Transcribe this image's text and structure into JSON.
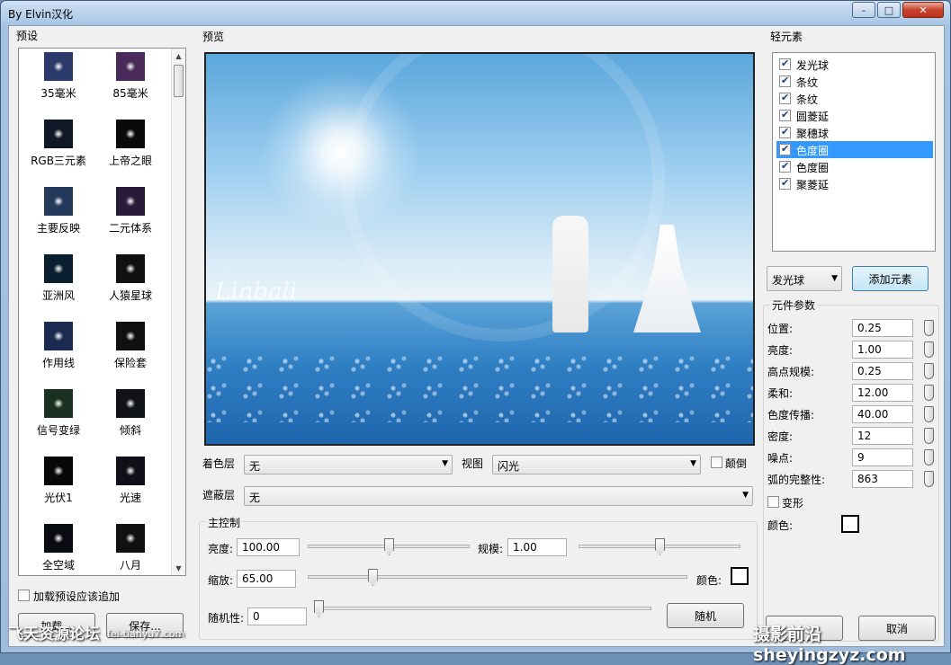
{
  "window": {
    "title": "By Elvin汉化",
    "minimize": "–",
    "maximize": "□",
    "close": "✕"
  },
  "presets": {
    "heading": "预设",
    "items": [
      {
        "label": "35毫米"
      },
      {
        "label": "85毫米"
      },
      {
        "label": "RGB三元素"
      },
      {
        "label": "上帝之眼"
      },
      {
        "label": "主要反映"
      },
      {
        "label": "二元体系"
      },
      {
        "label": "亚洲风"
      },
      {
        "label": "人猿星球"
      },
      {
        "label": "作用线"
      },
      {
        "label": "保险套"
      },
      {
        "label": "信号变绿"
      },
      {
        "label": "倾斜"
      },
      {
        "label": "光伏1"
      },
      {
        "label": "光速"
      },
      {
        "label": "全空域"
      },
      {
        "label": "八月"
      }
    ],
    "append_on_load_label": "加载预设应该追加",
    "load_button": "加载...",
    "save_button": "保存..."
  },
  "preview": {
    "heading": "预览",
    "watermark": "Linbali"
  },
  "layers": {
    "color_layer_label": "着色层",
    "color_layer_value": "无",
    "view_label": "视图",
    "view_value": "闪光",
    "invert_label": "颠倒",
    "mask_layer_label": "遮蔽层",
    "mask_layer_value": "无"
  },
  "master": {
    "heading": "主控制",
    "brightness_label": "亮度:",
    "brightness_value": "100.00",
    "brightness_pos": 0.5,
    "scale_label": "规模:",
    "scale_value": "1.00",
    "scale_pos": 0.5,
    "zoom_label": "缩放:",
    "zoom_value": "65.00",
    "zoom_pos": 0.17,
    "color_label": "颜色:",
    "randomness_label": "随机性:",
    "randomness_value": "0",
    "randomness_pos": 0.0,
    "random_button": "随机"
  },
  "elements": {
    "heading": "轻元素",
    "items": [
      {
        "label": "发光球",
        "checked": true
      },
      {
        "label": "条纹",
        "checked": true
      },
      {
        "label": "条纹",
        "checked": true
      },
      {
        "label": "圆菱延",
        "checked": true
      },
      {
        "label": "聚穗球",
        "checked": true
      },
      {
        "label": "色度圈",
        "checked": true,
        "selected": true
      },
      {
        "label": "色度圈",
        "checked": true
      },
      {
        "label": "聚菱延",
        "checked": true
      }
    ],
    "type_select_value": "发光球",
    "add_button": "添加元素"
  },
  "params": {
    "heading": "元件参数",
    "rows": [
      {
        "label": "位置:",
        "value": "0.25"
      },
      {
        "label": "亮度:",
        "value": "1.00"
      },
      {
        "label": "高点规模:",
        "value": "0.25"
      },
      {
        "label": "柔和:",
        "value": "12.00"
      },
      {
        "label": "色度传播:",
        "value": "40.00"
      },
      {
        "label": "密度:",
        "value": "12"
      },
      {
        "label": "噪点:",
        "value": "9"
      },
      {
        "label": "弧的完整性:",
        "value": "863"
      }
    ],
    "deform_label": "变形",
    "color_label": "颜色:"
  },
  "overlays": {
    "bottom_left": "飞天资源论坛",
    "bottom_left_url": "fei-tianyu7.com",
    "bottom_right": "摄影前沿 sheyingzyz.com",
    "cancel_partial": "取消"
  }
}
